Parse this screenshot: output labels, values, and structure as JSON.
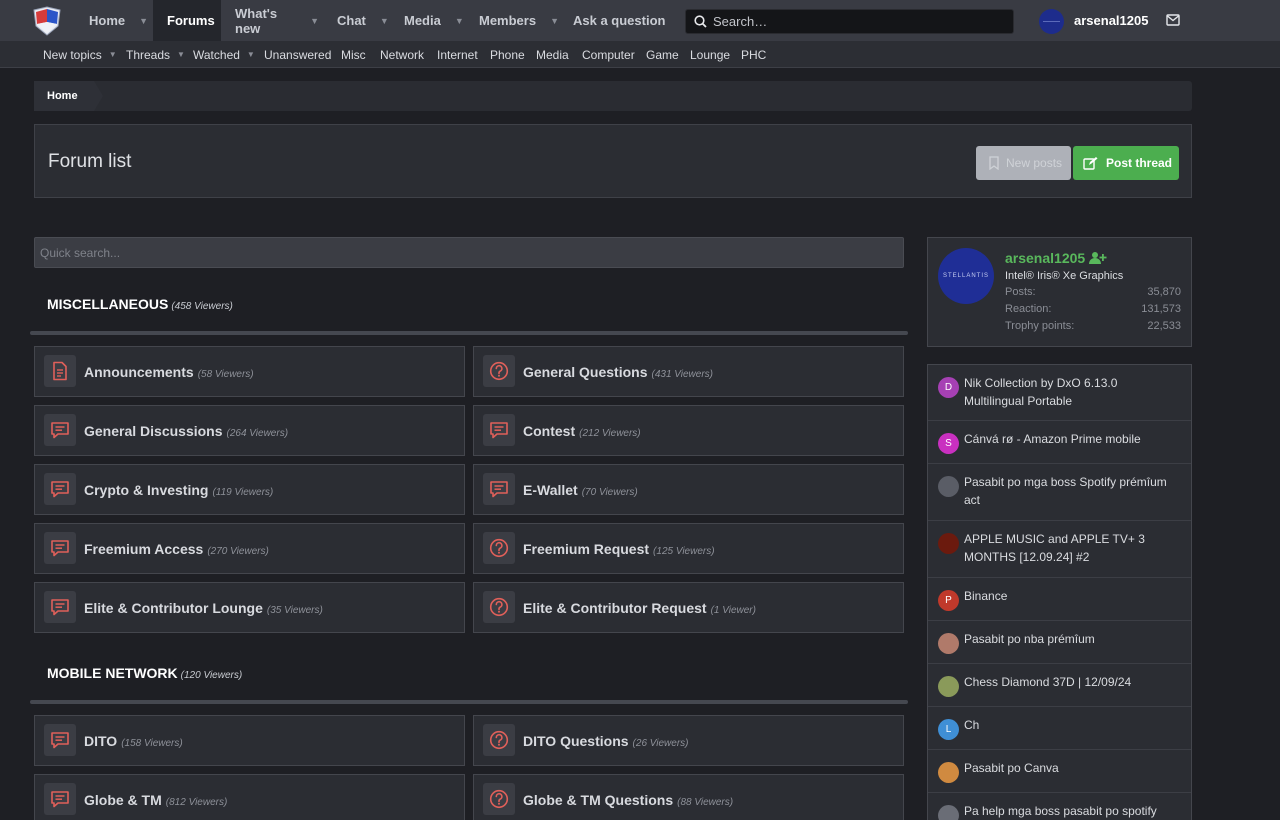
{
  "nav": {
    "items": [
      {
        "label": "Home",
        "caret": true,
        "active": false
      },
      {
        "label": "Forums",
        "caret": false,
        "active": true
      },
      {
        "label": "What's new",
        "caret": true,
        "active": false
      },
      {
        "label": "Chat",
        "caret": true,
        "active": false
      },
      {
        "label": "Media",
        "caret": true,
        "active": false
      },
      {
        "label": "Members",
        "caret": true,
        "active": false
      },
      {
        "label": "Ask a question",
        "caret": false,
        "active": false
      }
    ],
    "search_placeholder": "Search…",
    "username": "arsenal1205"
  },
  "subnav": {
    "items": [
      {
        "label": "New topics",
        "caret": true
      },
      {
        "label": "Threads",
        "caret": true
      },
      {
        "label": "Watched",
        "caret": true
      },
      {
        "label": "Unanswered",
        "caret": false
      },
      {
        "label": "Misc",
        "caret": false
      },
      {
        "label": "Network",
        "caret": false
      },
      {
        "label": "Internet",
        "caret": false
      },
      {
        "label": "Phone",
        "caret": false
      },
      {
        "label": "Media",
        "caret": false
      },
      {
        "label": "Computer",
        "caret": false
      },
      {
        "label": "Game",
        "caret": false
      },
      {
        "label": "Lounge",
        "caret": false
      },
      {
        "label": "PHC",
        "caret": false
      }
    ]
  },
  "breadcrumb": {
    "home": "Home"
  },
  "header": {
    "title": "Forum list",
    "new_posts": "New posts",
    "post_thread": "Post thread"
  },
  "quick_search": {
    "placeholder": "Quick search..."
  },
  "categories": [
    {
      "title": "MISCELLANEOUS",
      "viewers": "(458 Viewers)",
      "forums": [
        {
          "title": "Announcements",
          "viewers": "(58 Viewers)",
          "icon": "document"
        },
        {
          "title": "General Questions",
          "viewers": "(431 Viewers)",
          "icon": "question"
        },
        {
          "title": "General Discussions",
          "viewers": "(264 Viewers)",
          "icon": "chat"
        },
        {
          "title": "Contest",
          "viewers": "(212 Viewers)",
          "icon": "chat"
        },
        {
          "title": "Crypto & Investing",
          "viewers": "(119 Viewers)",
          "icon": "chat"
        },
        {
          "title": "E-Wallet",
          "viewers": "(70 Viewers)",
          "icon": "chat"
        },
        {
          "title": "Freemium Access",
          "viewers": "(270 Viewers)",
          "icon": "chat"
        },
        {
          "title": "Freemium Request",
          "viewers": "(125 Viewers)",
          "icon": "question"
        },
        {
          "title": "Elite & Contributor Lounge",
          "viewers": "(35 Viewers)",
          "icon": "chat"
        },
        {
          "title": "Elite & Contributor Request",
          "viewers": "(1 Viewer)",
          "icon": "question"
        }
      ]
    },
    {
      "title": "MOBILE NETWORK",
      "viewers": "(120 Viewers)",
      "forums": [
        {
          "title": "DITO",
          "viewers": "(158 Viewers)",
          "icon": "chat"
        },
        {
          "title": "DITO Questions",
          "viewers": "(26 Viewers)",
          "icon": "question"
        },
        {
          "title": "Globe & TM",
          "viewers": "(812 Viewers)",
          "icon": "chat"
        },
        {
          "title": "Globe & TM Questions",
          "viewers": "(88 Viewers)",
          "icon": "question"
        }
      ]
    }
  ],
  "profile": {
    "name": "arsenal1205",
    "title": "Intel® Iris® Xe Graphics",
    "avatar_text": "STELLANTIS",
    "stats": [
      {
        "label": "Posts:",
        "value": "35,870"
      },
      {
        "label": "Reaction:",
        "value": "131,573"
      },
      {
        "label": "Trophy points:",
        "value": "22,533"
      }
    ]
  },
  "latest_threads": [
    {
      "text": "Nik Collection by DxO 6.13.0 Multilingual Portable",
      "initial": "D",
      "color": "#a640b4"
    },
    {
      "text": "Cánvá rø - Amazon Prime mobile",
      "initial": "S",
      "color": "#c930c0"
    },
    {
      "text": "Pasabit po mga boss Spotify prémîum act",
      "initial": "",
      "color": "#5a5d66"
    },
    {
      "text": "APPLE MUSIC and APPLE TV+ 3 MONTHS [12.09.24] #2",
      "initial": "",
      "color": "#6b1a0e"
    },
    {
      "text": "Binance",
      "initial": "P",
      "color": "#c0392b"
    },
    {
      "text": "Pasabit po nba prémîum",
      "initial": "",
      "color": "#b07a6a"
    },
    {
      "text": "Chess Diamond 37D | 12/09/24",
      "initial": "",
      "color": "#8a9a5a"
    },
    {
      "text": "Ch",
      "initial": "L",
      "color": "#3f8fd6"
    },
    {
      "text": "Pasabit po Canva",
      "initial": "",
      "color": "#d08a40"
    },
    {
      "text": "Pa help mga boss pasabit po spotify",
      "initial": "",
      "color": "#6a6d76"
    }
  ]
}
